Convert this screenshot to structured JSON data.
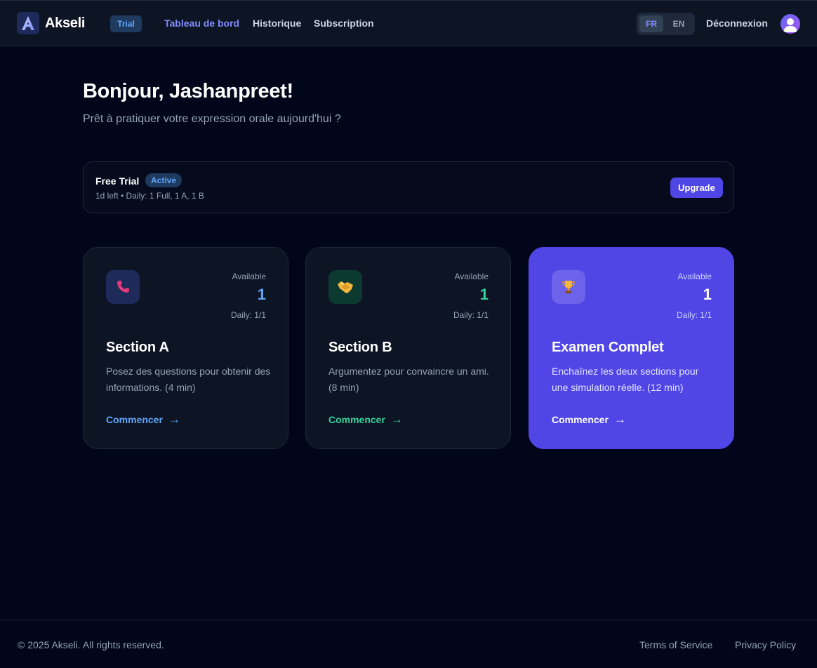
{
  "nav": {
    "brand": "Akseli",
    "badge": "Trial",
    "links": [
      "Tableau de bord",
      "Historique",
      "Subscription"
    ],
    "active_link": "Tableau de bord",
    "languages": [
      "FR",
      "EN"
    ],
    "selected_language": "FR",
    "logout": "Déconnexion"
  },
  "hero": {
    "greeting": "Bonjour, Jashanpreet!",
    "subtitle": "Prêt à pratiquer votre expression orale aujourd'hui ?"
  },
  "trial": {
    "title": "Free Trial",
    "status": "Active",
    "details": "1d left • Daily: 1 Full, 1 A, 1 B",
    "upgrade": "Upgrade"
  },
  "cards": [
    {
      "icon": "phone-icon",
      "available_label": "Available",
      "available_count": "1",
      "daily": "Daily: 1/1",
      "title": "Section A",
      "description": "Posez des questions pour obtenir des informations. (4 min)",
      "cta": "Commencer",
      "accent": "#60a5fa"
    },
    {
      "icon": "handshake-icon",
      "available_label": "Available",
      "available_count": "1",
      "daily": "Daily: 1/1",
      "title": "Section B",
      "description": "Argumentez pour convaincre un ami. (8 min)",
      "cta": "Commencer",
      "accent": "#34d399"
    },
    {
      "icon": "trophy-icon",
      "available_label": "Available",
      "available_count": "1",
      "daily": "Daily: 1/1",
      "title": "Examen Complet",
      "description": "Enchaînez les deux sections pour une simulation réelle. (12 min)",
      "cta": "Commencer",
      "accent": "#ffffff"
    }
  ],
  "cta_arrow": "→",
  "footer": {
    "copyright": "© 2025 Akseli. All rights reserved.",
    "links": [
      "Terms of Service",
      "Privacy Policy"
    ]
  },
  "colors": {
    "background": "#02061a",
    "navbar": "#0d1424",
    "accent": "#4f46e5",
    "active_link": "#818cf8"
  }
}
